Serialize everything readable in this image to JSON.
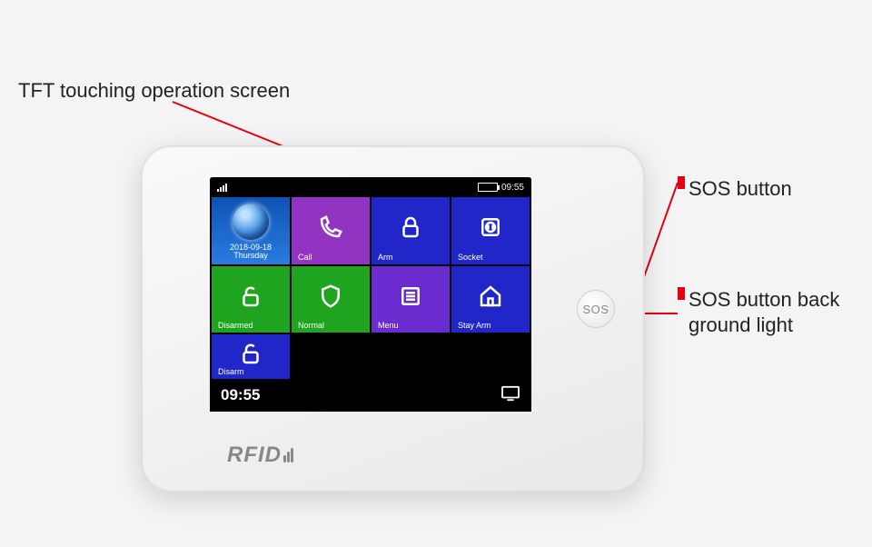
{
  "labels": {
    "tft": "TFT touching operation screen",
    "sos_button": "SOS button",
    "sos_light": "SOS button back ground light"
  },
  "device": {
    "brand": "RFID",
    "sos_text": "SOS"
  },
  "status": {
    "time_top": "09:55",
    "time_bottom": "09:55"
  },
  "hero": {
    "date": "2018-09-18",
    "weekday": "Thursday"
  },
  "tiles": {
    "call": "Call",
    "arm": "Arm",
    "socket": "Socket",
    "disarmed": "Disarmed",
    "normal": "Normal",
    "menu": "Menu",
    "stay_arm": "Stay Arm",
    "disarm": "Disarm"
  }
}
